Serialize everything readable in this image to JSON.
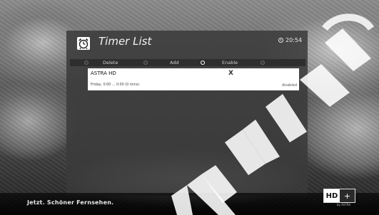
{
  "header": {
    "title": "Timer List",
    "time": "20:54"
  },
  "options": [
    {
      "label": "Delete",
      "selected": false
    },
    {
      "label": "Add",
      "selected": false
    },
    {
      "label": "Enable",
      "selected": true
    },
    {
      "label": "",
      "selected": false
    }
  ],
  "timers": [
    {
      "channel": "ASTRA HD",
      "marker": "X",
      "schedule": "Friday, 0:00 ... 0:00 (0 mins)",
      "status": "disabled"
    }
  ],
  "footer": {
    "slogan": "Jetzt. Schöner Fernsehen.",
    "logo_hd": "HD",
    "logo_plus": "+",
    "logo_sub": "by ASTRA"
  },
  "icons": {
    "title_icon": "alarm-clock-icon",
    "time_icon": "clock-icon"
  }
}
